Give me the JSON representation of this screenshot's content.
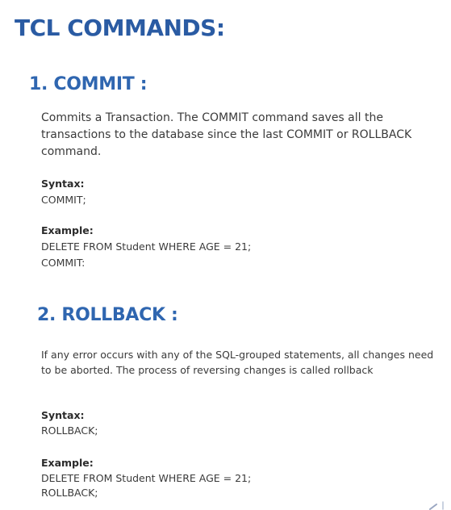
{
  "title": "TCL COMMANDS:",
  "sections": [
    {
      "heading": "1. COMMIT :",
      "description": "Commits a Transaction. The COMMIT command saves all the transactions to the database since the last COMMIT or ROLLBACK command.",
      "syntax_label": "Syntax:",
      "syntax": "COMMIT;",
      "example_label": "Example:",
      "example_lines": [
        "DELETE FROM Student WHERE AGE = 21;",
        "COMMIT:"
      ]
    },
    {
      "heading": "2. ROLLBACK :",
      "description": "If any error occurs with any of the SQL-grouped statements, all changes need to be aborted. The process of reversing changes is called rollback",
      "syntax_label": "Syntax:",
      "syntax": "ROLLBACK;",
      "example_label": "Example:",
      "example_lines": [
        "DELETE FROM Student WHERE AGE = 21;",
        "ROLLBACK;"
      ]
    }
  ],
  "colors": {
    "title": "#2a5ba3",
    "heading": "#2f66b0",
    "text": "#3a3a3a"
  }
}
